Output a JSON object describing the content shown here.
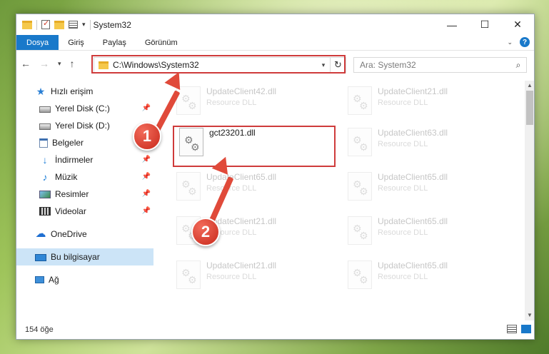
{
  "window": {
    "title": "System32",
    "controls": {
      "minimize": "—",
      "maximize": "☐",
      "close": "✕"
    }
  },
  "ribbon": {
    "tabs": [
      "Dosya",
      "Giriş",
      "Paylaş",
      "Görünüm"
    ]
  },
  "address": {
    "path": "C:\\Windows\\System32",
    "search_placeholder": "Ara: System32"
  },
  "nav_pane": {
    "quick_access": "Hızlı erişim",
    "items": [
      {
        "label": "Yerel Disk (C:)",
        "pinned": true
      },
      {
        "label": "Yerel Disk (D:)",
        "pinned": false
      },
      {
        "label": "Belgeler",
        "pinned": true
      },
      {
        "label": "İndirmeler",
        "pinned": true
      },
      {
        "label": "Müzik",
        "pinned": true
      },
      {
        "label": "Resimler",
        "pinned": true
      },
      {
        "label": "Videolar",
        "pinned": true
      }
    ],
    "onedrive": "OneDrive",
    "this_pc": "Bu bilgisayar",
    "network": "Ağ"
  },
  "files": {
    "highlighted": {
      "name": "gct23201.dll",
      "type": ""
    },
    "ghost_rows": [
      [
        {
          "name": "UpdateClient42.dll",
          "type": "Resource DLL"
        },
        {
          "name": "UpdateClient21.dll",
          "type": "Resource DLL"
        }
      ],
      [
        null,
        {
          "name": "UpdateClient63.dll",
          "type": "Resource DLL"
        }
      ],
      [
        {
          "name": "UpdateClient65.dll",
          "type": "Resource DLL"
        },
        {
          "name": "UpdateClient65.dll",
          "type": "Resource DLL"
        }
      ],
      [
        {
          "name": "UpdateClient21.dll",
          "type": "Resource DLL"
        },
        {
          "name": "UpdateClient65.dll",
          "type": "Resource DLL"
        }
      ],
      [
        {
          "name": "UpdateClient21.dll",
          "type": "Resource DLL"
        },
        {
          "name": "UpdateClient65.dll",
          "type": "Resource DLL"
        }
      ]
    ]
  },
  "status": {
    "count": "154 öğe"
  },
  "annotations": {
    "step1": "1",
    "step2": "2"
  },
  "colors": {
    "accent": "#1979ca",
    "highlight": "#cf3b3b",
    "badge": "#d83a2b",
    "selection": "#cce4f7"
  }
}
